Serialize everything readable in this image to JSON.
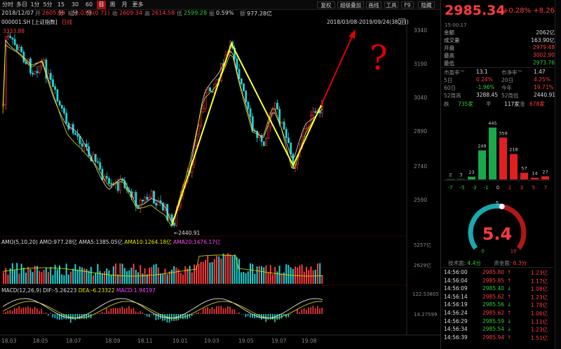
{
  "toolbar": {
    "periods": [
      "分时",
      "多日",
      "1分",
      "5分",
      "15分",
      "30分",
      "60分",
      "日",
      "周",
      "月",
      "更多"
    ],
    "active": "日",
    "right_buttons": [
      "复权",
      "超级叠加",
      "画线",
      "工具",
      "F9",
      "隐藏"
    ]
  },
  "info": {
    "date": "2018/12/07",
    "open_label": "开",
    "open": "2605.89",
    "change_label": "幅",
    "change": "0.03%(0.71)",
    "close_label": "收",
    "close": "2609.34",
    "high_label": "高",
    "high": "2614.58",
    "low_label": "低",
    "low": "2599.28",
    "amp_label": "振",
    "amp": "0.59%",
    "amount_label": "额",
    "amount": "977.28亿"
  },
  "chart_title": {
    "code": "000001.SH [上证指数]",
    "period": "日线",
    "range": "2018/03/08-2019/09/24(380日)"
  },
  "annotations": {
    "top_left_price": "3333.88",
    "low_price": "←2440.91",
    "question": "?"
  },
  "price_axis": [
    "3340",
    "3190",
    "3040",
    "2890",
    "2740",
    "2590"
  ],
  "volume_panel": {
    "legend_amo": "AMO(5,10,20)",
    "amo": "AMO:977.28亿",
    "ama5": "AMA5:1385.05亿",
    "ama10": "AMA10:1264.18亿",
    "ama20": "AMA20:1476.17亿",
    "axis": [
      "5257亿",
      "2629亿"
    ]
  },
  "macd_panel": {
    "legend": "MACD(12,26,9)",
    "dif": "DIF:-5.26223",
    "dea": "DEA:-6.23322",
    "macd": "MACD:1.94197",
    "axis": [
      "122.53805",
      "14.27599"
    ]
  },
  "x_axis": [
    "18.03",
    "18.05",
    "18.07",
    "18.09",
    "18.11",
    "19.01",
    "19.03",
    "19.05",
    "19.07",
    "19.08"
  ],
  "right_panel": {
    "price": "2985.34",
    "change": "+0.28%  +8.26",
    "time": "15:00:17",
    "quote": [
      {
        "k": "金额",
        "v": "2062亿",
        "c": "white"
      },
      {
        "k": "成交量",
        "v": "163.90亿",
        "c": "white"
      },
      {
        "k": "开盘",
        "v": "2979.48",
        "c": "red"
      },
      {
        "k": "最高",
        "v": "3002.90",
        "c": "red"
      },
      {
        "k": "最低",
        "v": "2973.76",
        "c": "green"
      }
    ],
    "valuation": [
      {
        "l1": "市盈率™",
        "v1": "13.1",
        "l2": "市净率™",
        "v2": "1.47",
        "c1": "white",
        "c2": "white"
      },
      {
        "l1": "5日",
        "v1": "0.24%",
        "l2": "20日",
        "v2": "4.25%",
        "c1": "red",
        "c2": "red"
      },
      {
        "l1": "60日",
        "v1": "-1.96%",
        "l2": "今年",
        "v2": "19.71%",
        "c1": "green",
        "c2": "red"
      },
      {
        "l1": "52周高",
        "v1": "3288.45",
        "l2": "52周低",
        "v2": "2440.91",
        "c1": "white",
        "c2": "white"
      }
    ],
    "breadth": {
      "fall_label": "跌",
      "fall": "735家",
      "flat_label": "平",
      "flat": "117家",
      "rise_label": "涨",
      "rise": "678家"
    },
    "histogram": {
      "labels": [
        "-7",
        "-5",
        "-3",
        "-1",
        "0",
        "1",
        "3",
        "5",
        "7"
      ],
      "values": [
        2,
        3,
        23,
        249,
        445,
        359,
        218,
        57,
        14,
        27
      ],
      "colors": [
        "#1aa84a",
        "#1aa84a",
        "#1aa84a",
        "#1aa84a",
        "#1aa84a",
        "#e02020",
        "#e02020",
        "#e02020",
        "#e02020",
        "#e02020"
      ]
    },
    "gauge": {
      "value": "5.4",
      "level": 0.54,
      "min": "0",
      "max": "10",
      "mid": "5"
    },
    "gauge_footer": {
      "tech_label": "技术面:",
      "tech": "4.4分",
      "fund_label": "资金面:",
      "fund": "6.3分"
    },
    "ticks": [
      {
        "t": "14:56:00",
        "p": "2985.80",
        "d": "up",
        "v": "1.23亿"
      },
      {
        "t": "14:56:04",
        "p": "2985.85",
        "d": "up",
        "v": "1.17亿"
      },
      {
        "t": "14:56:09",
        "p": "2985.40",
        "d": "down",
        "v": "1.08亿"
      },
      {
        "t": "14:56:14",
        "p": "2985.62",
        "d": "up",
        "v": "1.23亿"
      },
      {
        "t": "14:56:19",
        "p": "2985.56",
        "d": "down",
        "v": "1.78亿"
      },
      {
        "t": "14:56:24",
        "p": "2985.62",
        "d": "up",
        "v": "1.06亿"
      },
      {
        "t": "14:56:29",
        "p": "2985.59",
        "d": "down",
        "v": "1.11亿"
      },
      {
        "t": "14:56:34",
        "p": "2985.54",
        "d": "down",
        "v": "1.23亿"
      },
      {
        "t": "14:56:39",
        "p": "2985.94",
        "d": "up",
        "v": "1.51亿"
      }
    ]
  },
  "colors": {
    "up": "#ff3b3b",
    "down": "#22d3d3",
    "pattern": "#ffff33",
    "arrow": "#e00000"
  }
}
